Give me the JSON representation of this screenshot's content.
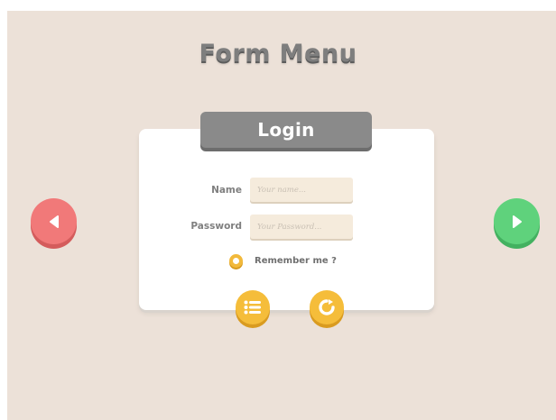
{
  "screen": {
    "title": "Form Menu"
  },
  "login_panel": {
    "header": "Login",
    "fields": [
      {
        "label": "Name",
        "placeholder": "Your name..."
      },
      {
        "label": "Password",
        "placeholder": "Your Password..."
      }
    ],
    "remember": {
      "label": "Remember me ?",
      "checked": false
    }
  },
  "buttons": {
    "list_icon": "list-icon",
    "refresh_icon": "refresh-icon",
    "prev_icon": "arrow-left-icon",
    "next_icon": "arrow-right-icon"
  },
  "colors": {
    "background": "#ece1d8",
    "title_gray": "#7e7e7e",
    "header_plate": "#8a8a8a",
    "field_bg": "#f5ebdc",
    "accent_orange": "#f5bd3a",
    "prev_red": "#f17979",
    "next_green": "#5fd27c"
  }
}
